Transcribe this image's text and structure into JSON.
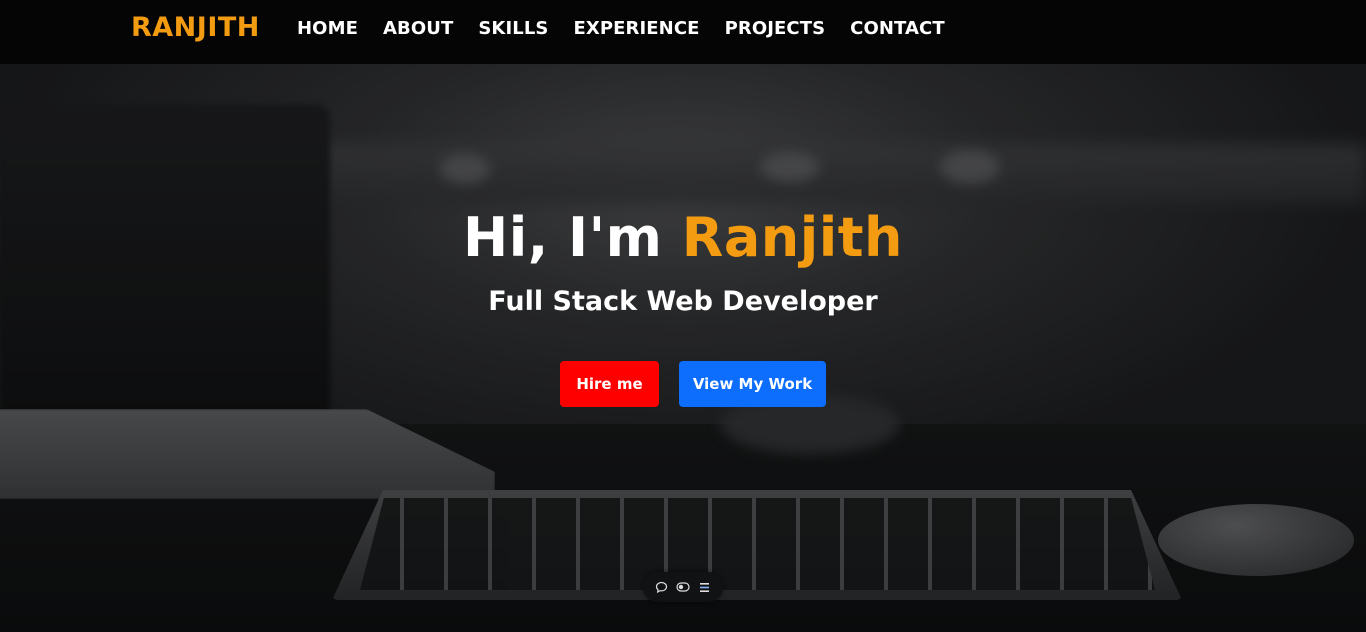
{
  "navbar": {
    "brand": "RANJITH",
    "links": [
      "HOME",
      "ABOUT",
      "SKILLS",
      "EXPERIENCE",
      "PROJECTS",
      "CONTACT"
    ]
  },
  "hero": {
    "greeting": "Hi, I'm",
    "name": "Ranjith",
    "subtitle": "Full Stack Web Developer",
    "hire_button": "Hire me",
    "work_button": "View My Work"
  },
  "toolbar": {
    "icons": [
      "chat-bubble-icon",
      "toggle-icon",
      "list-icon"
    ]
  },
  "colors": {
    "brand_accent": "#f39c12",
    "hire_button": "#ff0000",
    "work_button": "#0d6efd",
    "navbar_bg": "#050505"
  }
}
